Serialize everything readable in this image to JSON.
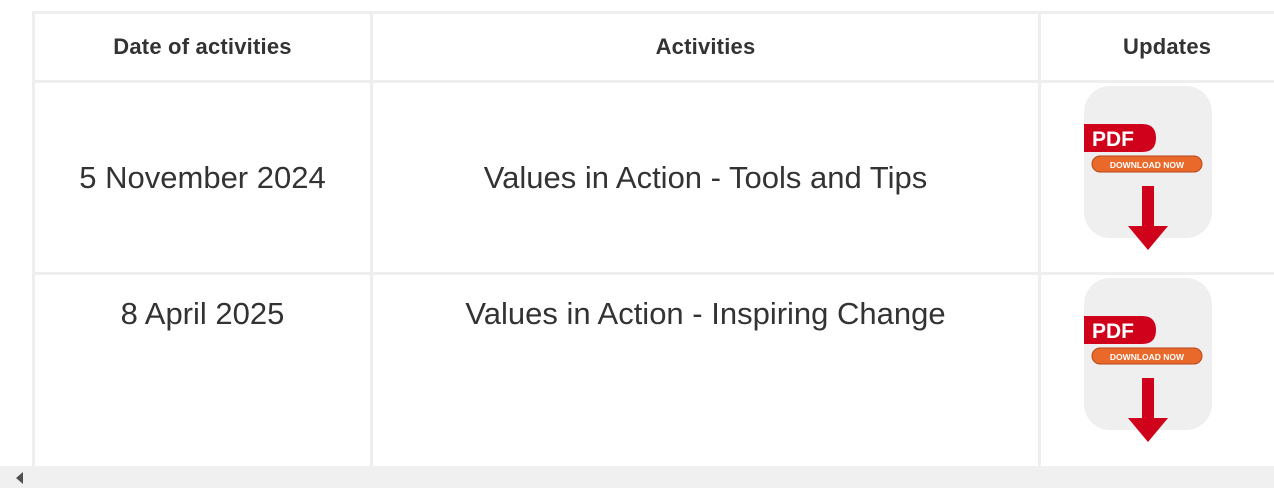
{
  "table": {
    "headers": {
      "date": "Date of activities",
      "activities": "Activities",
      "updates": "Updates"
    },
    "rows": [
      {
        "date": "5 November 2024",
        "activity": "Values in Action - Tools and Tips",
        "update": {
          "icon": "pdf-download-icon",
          "badge": "PDF",
          "button": "DOWNLOAD NOW"
        }
      },
      {
        "date": "8 April 2025",
        "activity": "Values in Action - Inspiring Change",
        "update": {
          "icon": "pdf-download-icon",
          "badge": "PDF",
          "button": "DOWNLOAD NOW"
        }
      }
    ]
  },
  "colors": {
    "border": "#eeeeee",
    "text": "#333333",
    "pdf_red": "#d0021b",
    "download_orange": "#e8692a",
    "icon_bg": "#efefef",
    "scrollbar": "#f0f0f0"
  },
  "scrollbar": {
    "left_arrow_icon": "scroll-left-arrow-icon"
  }
}
